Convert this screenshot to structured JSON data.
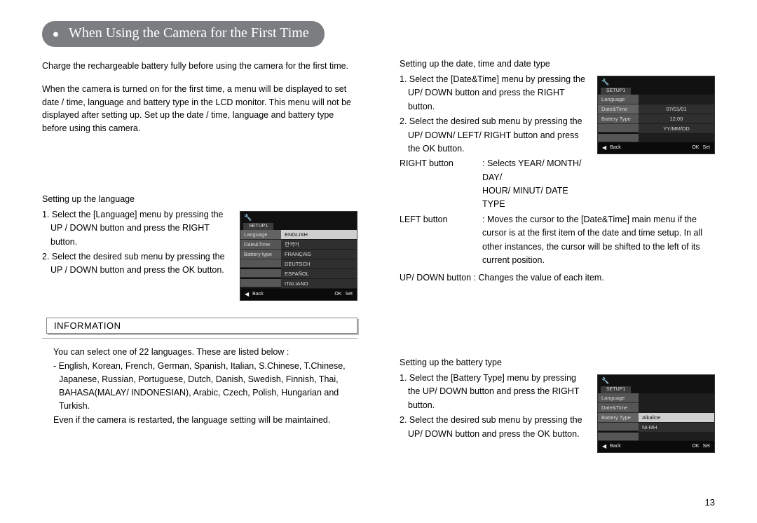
{
  "title": "When Using the Camera for the First Time",
  "intro1": "Charge the rechargeable battery fully before using the camera for the first time.",
  "intro2": "When the camera is turned on for the first time, a menu will be displayed to set date / time, language and battery type in the LCD monitor. This menu will not be displayed after setting up. Set up the date / time, language and battery type before using this camera.",
  "lang": {
    "head": "Setting up the language",
    "step1": "1. Select the [Language] menu by pressing the UP / DOWN button and press the RIGHT button.",
    "step2": "2. Select the desired sub menu by pressing the UP / DOWN button and press the OK button."
  },
  "lcd_lang": {
    "tab": "SETUP1",
    "left": [
      "Language",
      "Date&Time",
      "Battery type"
    ],
    "right": [
      "ENGLISH",
      "한국어",
      "FRANÇAIS",
      "DEUTSCH",
      "ESPAÑOL",
      "ITALIANO"
    ],
    "selected": 0,
    "back_arrow": "◀",
    "back": "Back",
    "ok": "OK",
    "set": "Set"
  },
  "info": {
    "head": "INFORMATION",
    "p1": "You can select one of 22 languages. These are listed below :",
    "p2": "- English, Korean, French, German, Spanish, Italian, S.Chinese, T.Chinese, Japanese, Russian, Portuguese, Dutch, Danish, Swedish, Finnish, Thai, BAHASA(MALAY/ INDONESIAN), Arabic, Czech, Polish, Hungarian and Turkish.",
    "p3": "Even if the camera is restarted, the language setting will be maintained."
  },
  "dt": {
    "head": "Setting up the date, time and date type",
    "step1": "1. Select the [Date&Time] menu by pressing the UP/ DOWN button and press the RIGHT button.",
    "step2": "2. Select the desired sub menu by pressing the UP/ DOWN/ LEFT/ RIGHT button and press the OK button.",
    "right_lbl": "RIGHT button",
    "right_val": ": Selects YEAR/ MONTH/ DAY/",
    "right_val2": "HOUR/ MINUT/ DATE TYPE",
    "left_lbl": "LEFT button",
    "left_val": ": Moves the cursor to the [Date&Time] main menu if the cursor is at the first item of the date and time setup. In all other instances, the cursor will be shifted to the left of its current position.",
    "ud": "UP/ DOWN button : Changes the value of each item."
  },
  "lcd_dt": {
    "tab": "SETUP1",
    "left": [
      "Language",
      "Date&Time",
      "Battery Type"
    ],
    "right": [
      "07/01/01",
      "12:00",
      "YY/MM/DD"
    ],
    "back_arrow": "◀",
    "back": "Back",
    "ok": "OK",
    "set": "Set"
  },
  "bat": {
    "head": "Setting up the battery type",
    "step1": "1. Select the [Battery Type] menu by pressing the UP/ DOWN button and press the RIGHT button.",
    "step2": "2. Select the desired sub menu by pressing the UP/ DOWN button and press the OK button."
  },
  "lcd_bat": {
    "tab": "SETUP1",
    "left": [
      "Language",
      "Date&Time",
      "Battery Type"
    ],
    "right": [
      "Alkaline",
      "Ni-MH"
    ],
    "selected": 0,
    "back_arrow": "◀",
    "back": "Back",
    "ok": "OK",
    "set": "Set"
  },
  "page_num": "13"
}
